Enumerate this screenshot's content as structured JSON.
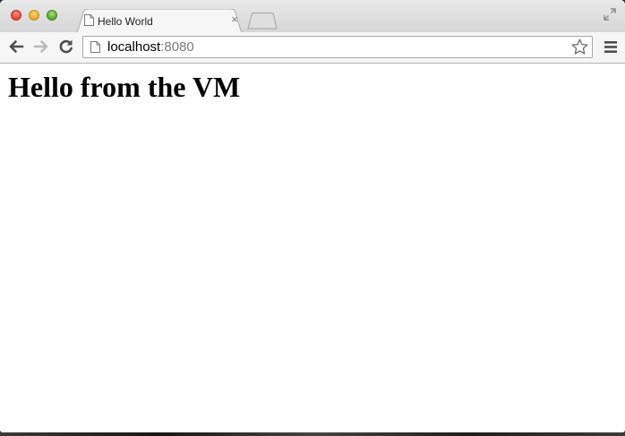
{
  "window": {
    "controls": [
      "close",
      "minimize",
      "zoom"
    ]
  },
  "tab": {
    "title": "Hello World",
    "favicon": "page-icon",
    "close_glyph": "×"
  },
  "toolbar": {
    "back": "back-arrow-icon",
    "forward": "forward-arrow-icon",
    "reload": "reload-icon",
    "menu": "hamburger-menu-icon"
  },
  "omnibox": {
    "host": "localhost",
    "port": ":8080",
    "bookmark": "star-icon"
  },
  "page": {
    "heading": "Hello from the VM"
  },
  "colors": {
    "close": "#e0443e",
    "minimize": "#e8a523",
    "zoom": "#5aa332"
  }
}
